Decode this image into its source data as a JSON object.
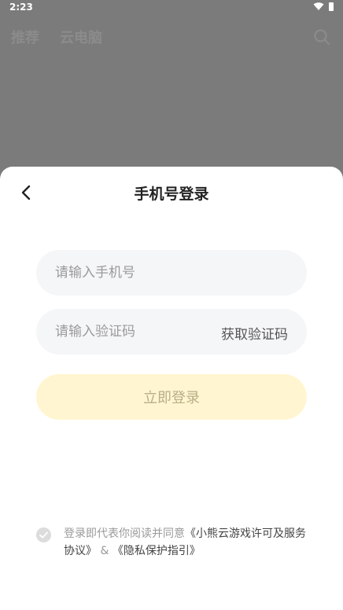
{
  "status_bar": {
    "time": "2:23"
  },
  "background": {
    "tabs": [
      "推荐",
      "云电脑"
    ]
  },
  "sheet": {
    "title": "手机号登录",
    "phone_placeholder": "请输入手机号",
    "code_placeholder": "请输入验证码",
    "get_code_label": "获取验证码",
    "login_label": "立即登录",
    "agreement": {
      "prefix": "登录即代表你阅读并同意",
      "license_link": "《小熊云游戏许可及服务协议》",
      "separator": " & ",
      "privacy_link": "《隐私保护指引》"
    }
  },
  "colors": {
    "overlay": "#7b7b7b",
    "field_bg": "#f5f6f8",
    "login_button_bg": "#fff6d1",
    "login_button_text": "#b9ae86"
  },
  "icons": [
    "wifi-icon",
    "battery-icon",
    "search-icon",
    "back-icon",
    "check-icon"
  ]
}
